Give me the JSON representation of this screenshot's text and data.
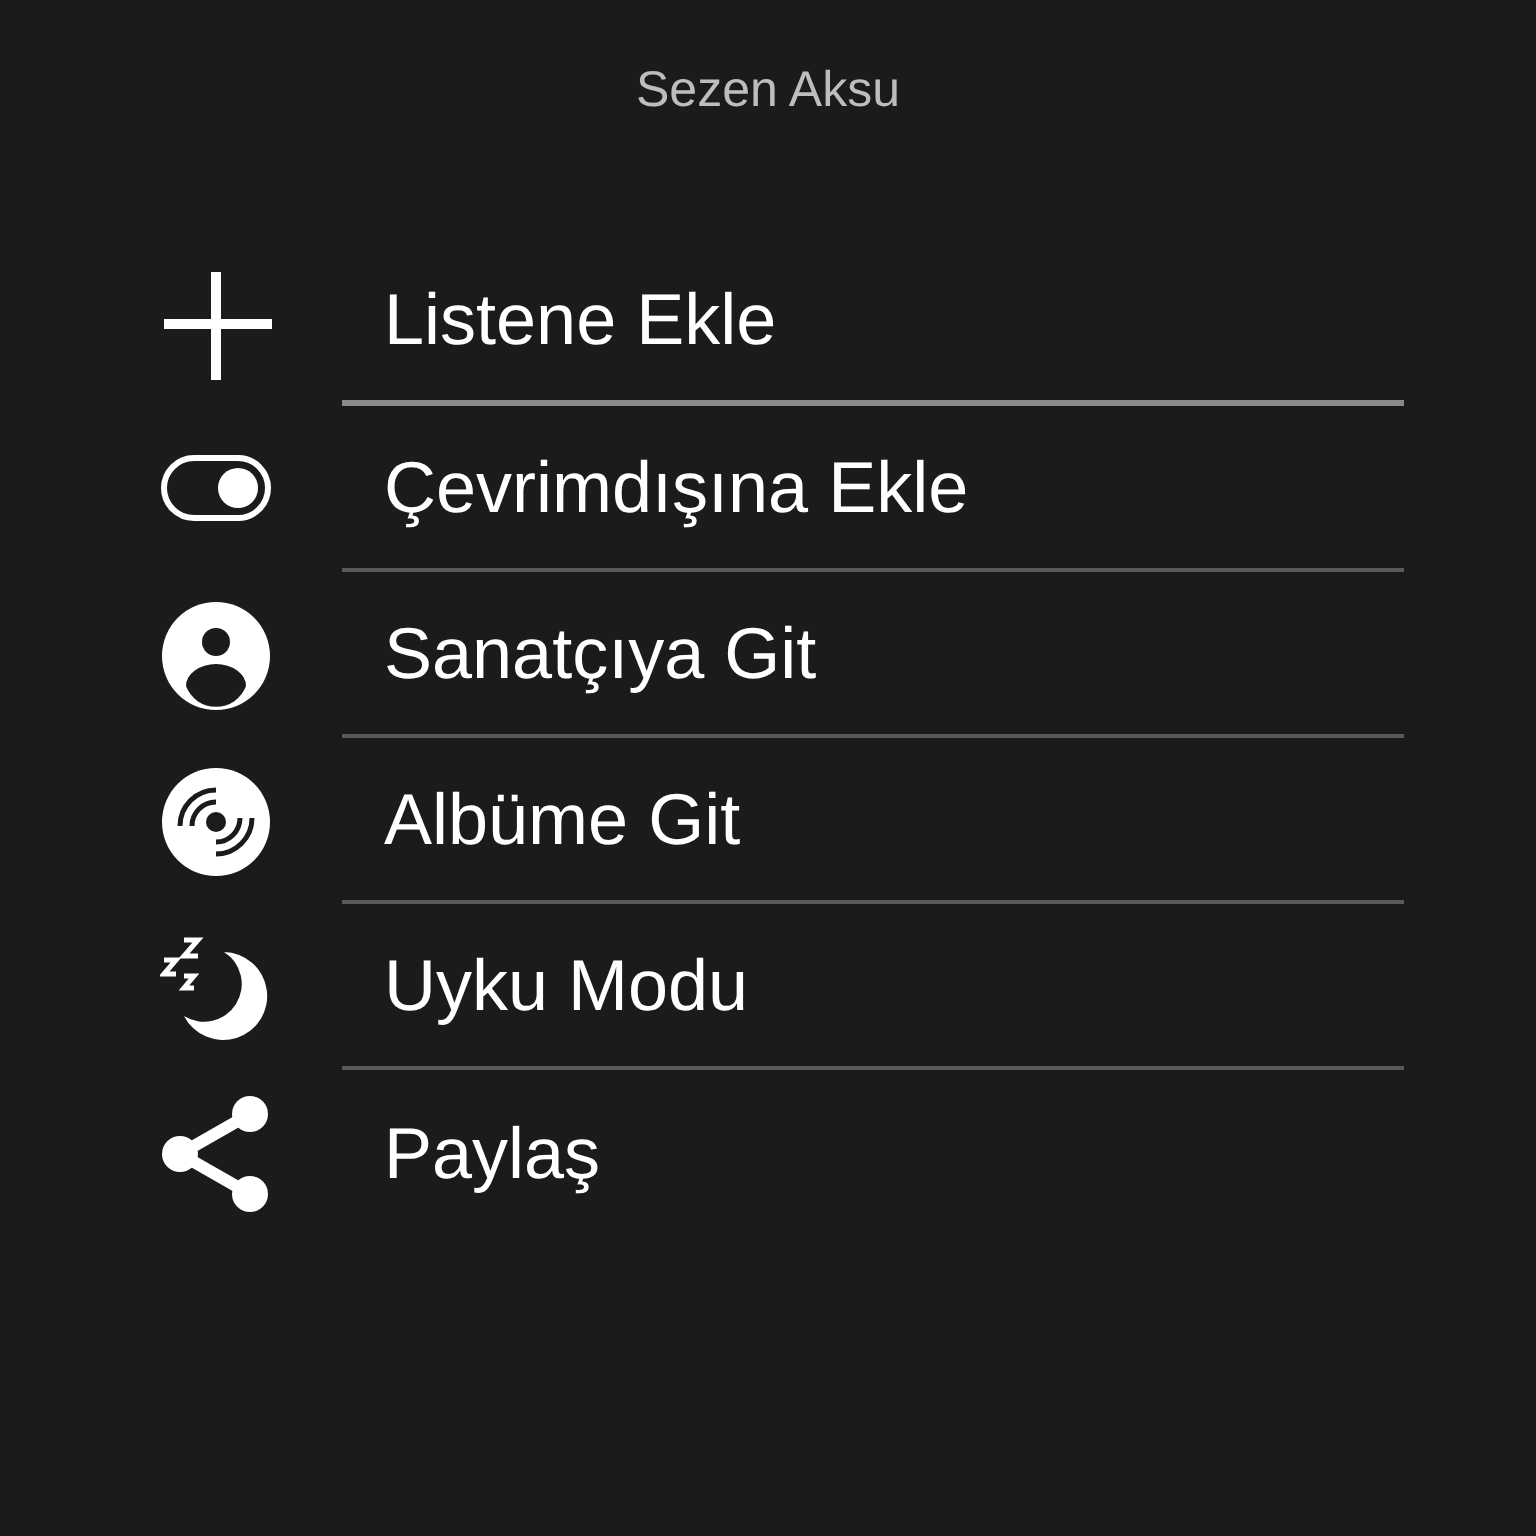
{
  "header": {
    "title": "Sezen Aksu"
  },
  "menu": [
    {
      "kind": "plus",
      "label": "Listene Ekle",
      "selected": true
    },
    {
      "kind": "toggle",
      "label": "Çevrimdışına Ekle",
      "selected": false
    },
    {
      "kind": "person",
      "label": "Sanatçıya Git",
      "selected": false
    },
    {
      "kind": "disc",
      "label": "Albüme Git",
      "selected": false
    },
    {
      "kind": "sleep",
      "label": "Uyku Modu",
      "selected": false
    },
    {
      "kind": "share",
      "label": "Paylaş",
      "selected": false
    }
  ]
}
